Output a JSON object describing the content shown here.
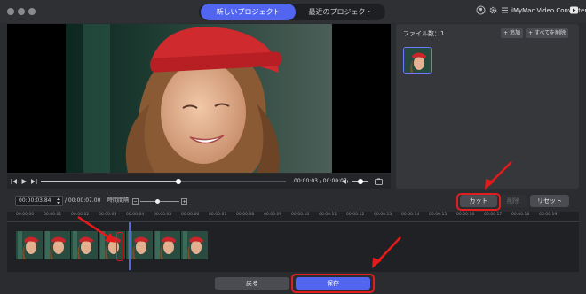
{
  "tabs": {
    "new_project": "新しいプロジェクト",
    "recent_projects": "最近のプロジェクト"
  },
  "app": {
    "brand": "iMyMac Video Converter"
  },
  "file_panel": {
    "file_count": "ファイル数：1",
    "add": "追加",
    "delete_all": "すべてを削除"
  },
  "player": {
    "time_display": "00:00:03 / 00:00:07"
  },
  "toolbar": {
    "start_time": "00:00:03.84",
    "total_time": "/ 00:00:07.00",
    "interval_label": "時間間隔",
    "cut_label": "カット",
    "delete_label": "削除",
    "reset_label": "リセット"
  },
  "timeline": {
    "ticks": [
      "00:00:00",
      "00:00:01",
      "00:00:02",
      "00:00:03",
      "00:00:04",
      "00:00:05",
      "00:00:06",
      "00:00:07",
      "00:00:08",
      "00:00:09",
      "00:00:10",
      "00:00:11",
      "00:00:12",
      "00:00:13",
      "00:00:14",
      "00:00:15",
      "00:00:16",
      "00:00:17",
      "00:00:18",
      "00:00:19"
    ],
    "playhead_seconds": 3.84
  },
  "bottom": {
    "back_label": "戻る",
    "save_label": "保存"
  },
  "colors": {
    "accent": "#5165f0",
    "annotation": "#e11d1d"
  }
}
